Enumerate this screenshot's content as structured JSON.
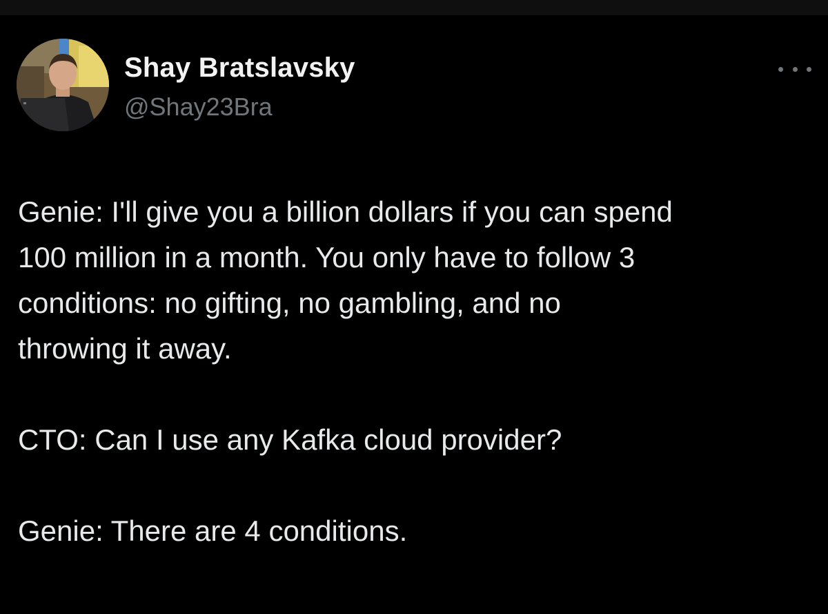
{
  "tweet": {
    "author": {
      "name": "Shay Bratslavsky",
      "handle": "@Shay23Bra",
      "avatar_icon": "profile-photo"
    },
    "more_icon": "ellipsis-icon",
    "paragraphs": [
      "Genie: I'll give you a billion dollars if you can spend\n100 million in a month. You only have to follow 3\nconditions: no gifting, no gambling, and no\nthrowing it away.",
      "CTO: Can I use any Kafka cloud provider?",
      "Genie: There are 4 conditions."
    ]
  },
  "colors": {
    "background": "#000000",
    "text": "#e7e9ea",
    "secondary_text": "#71767b"
  }
}
